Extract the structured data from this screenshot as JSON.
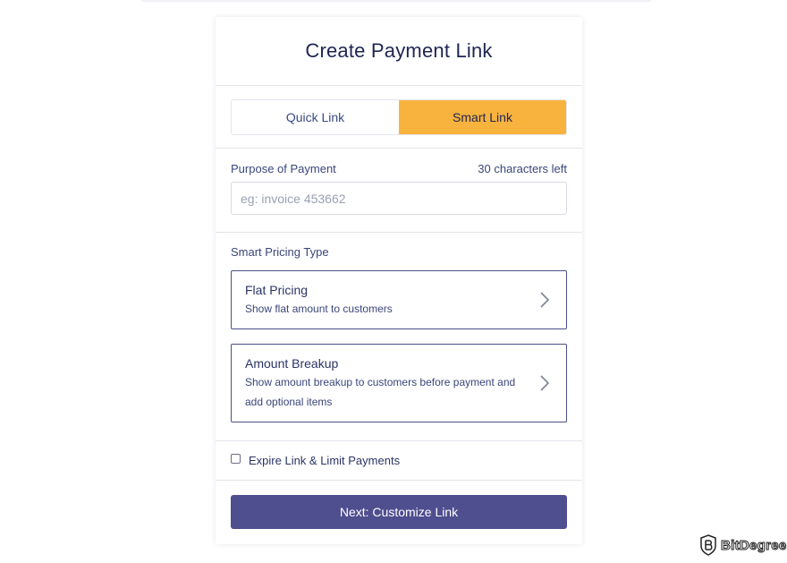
{
  "card": {
    "title": "Create Payment Link"
  },
  "tabs": [
    {
      "label": "Quick Link",
      "active": false
    },
    {
      "label": "Smart Link",
      "active": true
    }
  ],
  "purpose": {
    "label": "Purpose of Payment",
    "chars_left": "30 characters left",
    "placeholder": "eg: invoice 453662",
    "value": ""
  },
  "pricing": {
    "label": "Smart Pricing Type",
    "options": [
      {
        "title": "Flat Pricing",
        "description": "Show flat amount to customers"
      },
      {
        "title": "Amount Breakup",
        "description": "Show amount breakup to customers before payment and add optional items"
      }
    ]
  },
  "expire": {
    "label": "Expire Link & Limit Payments",
    "checked": false
  },
  "next_button": {
    "label": "Next: Customize Link"
  },
  "watermark": {
    "text": "BitDegree"
  },
  "colors": {
    "accent_tab": "#f8b33f",
    "primary_button": "#4f4e8f",
    "text_dark": "#1e2552",
    "option_border": "#4a4f8a"
  },
  "icons": {
    "option_arrow": "chevron-right-icon",
    "watermark_logo": "bitdegree-shield-icon"
  }
}
